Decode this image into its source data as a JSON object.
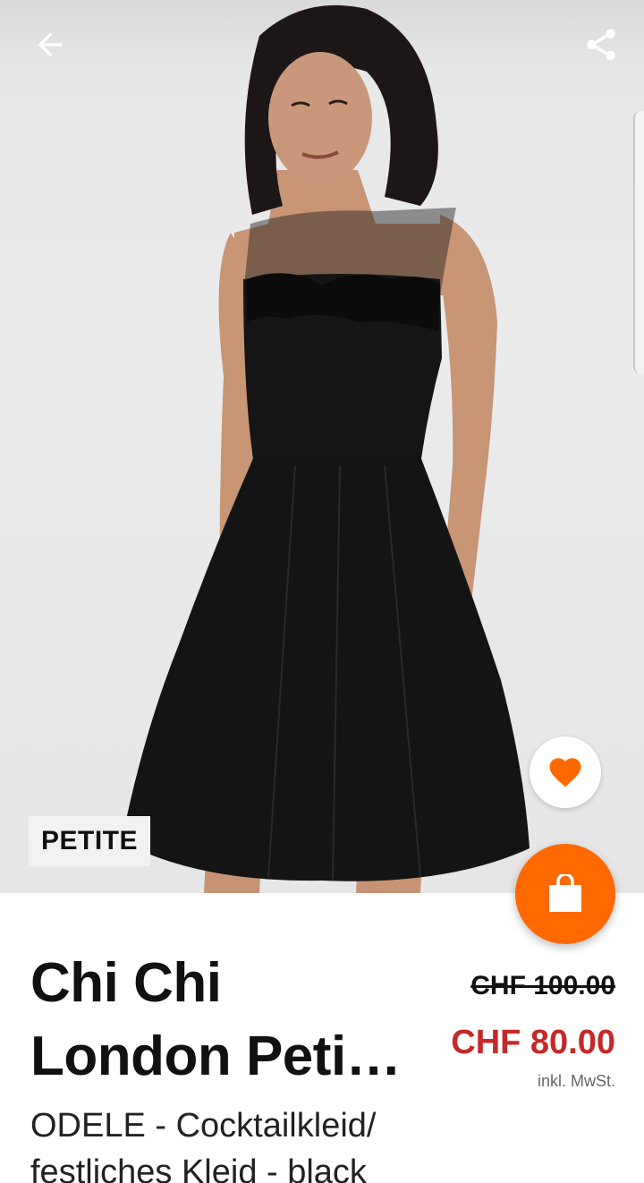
{
  "hero": {
    "badge": "PETITE"
  },
  "icons": {
    "back": "arrow-left-icon",
    "share": "share-icon",
    "wishlist": "heart-icon",
    "cart": "shopping-bag-icon"
  },
  "colors": {
    "accent": "#ff6900",
    "sale_price": "#c62828",
    "text": "#111111"
  },
  "product": {
    "name_line1": "Chi Chi",
    "name_line2": "London Peti…",
    "description_line1": "ODELE - Cocktailkleid/",
    "description_line2": "festliches Kleid - black",
    "price_old": "CHF 100.00",
    "price_new": "CHF 80.00",
    "price_note": "inkl. MwSt."
  }
}
